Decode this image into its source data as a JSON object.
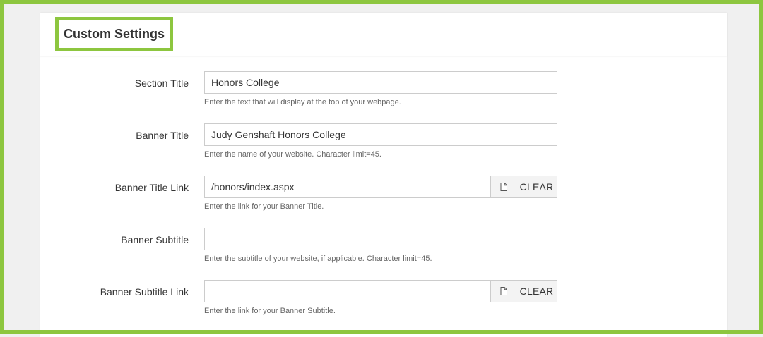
{
  "panel": {
    "title": "Custom Settings"
  },
  "fields": {
    "section_title": {
      "label": "Section Title",
      "value": "Honors College",
      "help": "Enter the text that will display at the top of your webpage."
    },
    "banner_title": {
      "label": "Banner Title",
      "value": "Judy Genshaft Honors College",
      "help": "Enter the name of your website. Character limit=45."
    },
    "banner_title_link": {
      "label": "Banner Title Link",
      "value": "/honors/index.aspx",
      "help": "Enter the link for your Banner Title.",
      "clear_label": "CLEAR",
      "browse_icon": "file-icon"
    },
    "banner_subtitle": {
      "label": "Banner Subtitle",
      "value": "",
      "help": "Enter the subtitle of your website, if applicable. Character limit=45."
    },
    "banner_subtitle_link": {
      "label": "Banner Subtitle Link",
      "value": "",
      "help": "Enter the link for your Banner Subtitle.",
      "clear_label": "CLEAR",
      "browse_icon": "file-icon"
    }
  },
  "colors": {
    "highlight": "#8dc63f",
    "border": "#cccccc",
    "text": "#333333",
    "help_text": "#666666"
  }
}
